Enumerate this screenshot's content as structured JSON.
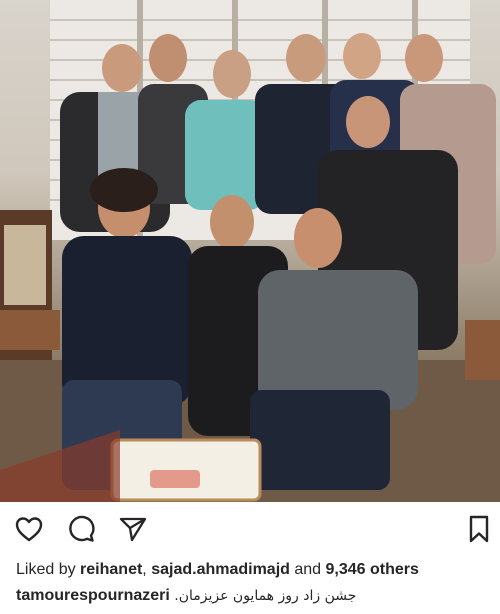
{
  "post": {
    "image": {
      "alt": ""
    },
    "actions": {
      "like": "heart-icon",
      "comment": "comment-bubble-icon",
      "share": "send-paper-plane-icon",
      "save": "bookmark-icon"
    },
    "likes": {
      "prefix": "Liked by",
      "user1": "reihanet",
      "separator": ",",
      "user2": "sajad.ahmadimajd",
      "and": "and",
      "count": "9,346 others"
    },
    "caption": {
      "username": "tamourespournazeri",
      "text": "جشن زاد روز همایون عزیزمان."
    }
  }
}
